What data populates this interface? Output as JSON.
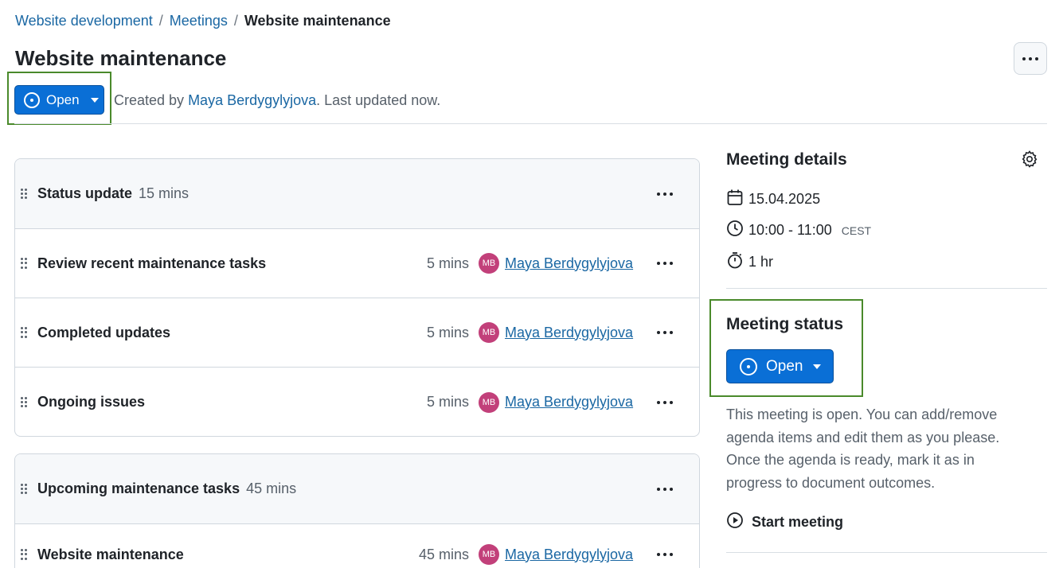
{
  "breadcrumb": {
    "items": [
      "Website development",
      "Meetings"
    ],
    "current": "Website maintenance",
    "separator": "/"
  },
  "page": {
    "title": "Website maintenance",
    "status_label": "Open",
    "created_by_prefix": "Created by ",
    "creator": "Maya Berdygylyjova",
    "updated_suffix": ". Last updated now."
  },
  "sections": [
    {
      "title": "Status update",
      "duration": "15 mins",
      "items": [
        {
          "title": "Review recent maintenance tasks",
          "duration": "5 mins",
          "avatar": "MB",
          "presenter": "Maya Berdygylyjova"
        },
        {
          "title": "Completed updates",
          "duration": "5 mins",
          "avatar": "MB",
          "presenter": "Maya Berdygylyjova"
        },
        {
          "title": "Ongoing issues",
          "duration": "5 mins",
          "avatar": "MB",
          "presenter": "Maya Berdygylyjova"
        }
      ]
    },
    {
      "title": "Upcoming maintenance tasks",
      "duration": "45 mins",
      "items": [
        {
          "title": "Website maintenance",
          "duration": "45 mins",
          "avatar": "MB",
          "presenter": "Maya Berdygylyjova"
        }
      ]
    }
  ],
  "details": {
    "title": "Meeting details",
    "date": "15.04.2025",
    "time": "10:00 - 11:00",
    "timezone": "CEST",
    "length": "1 hr"
  },
  "status": {
    "title": "Meeting status",
    "button_label": "Open",
    "description": "This meeting is open. You can add/remove agenda items and edit them as you please. Once the agenda is ready, mark it as in progress to document outcomes.",
    "start_label": "Start meeting"
  },
  "colors": {
    "accent": "#0a6fd6",
    "link": "#1a67a3",
    "highlight": "#4a8a2b",
    "avatar": "#c2407a"
  }
}
